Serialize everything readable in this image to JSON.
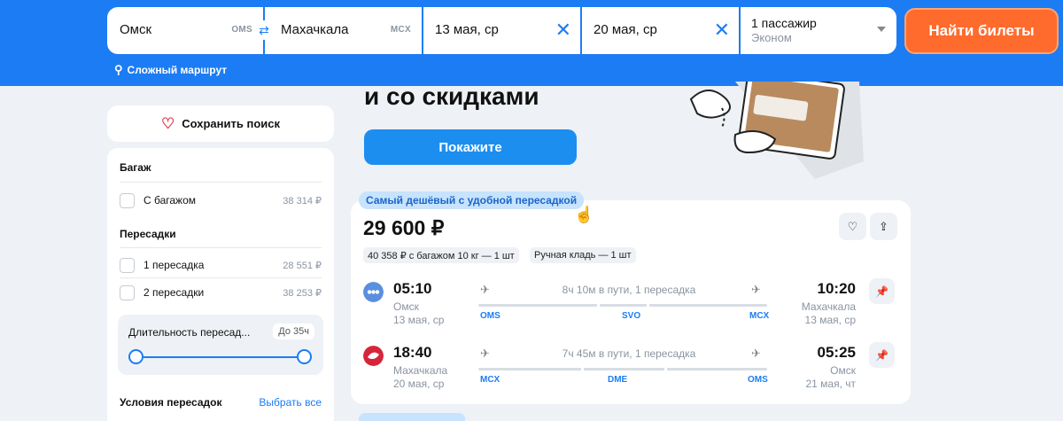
{
  "search": {
    "from_city": "Омск",
    "from_code": "OMS",
    "to_city": "Махачкала",
    "to_code": "MCX",
    "date_there": "13 мая, ср",
    "date_back": "20 мая, ср",
    "passengers": "1 пассажир",
    "cabin_class": "Эконом",
    "submit_label": "Найти билеты",
    "complex_route": "Сложный маршрут"
  },
  "promo": {
    "title": "и со скидками",
    "button": "Покажите"
  },
  "sidebar": {
    "save_search": "Сохранить поиск",
    "baggage_title": "Багаж",
    "baggage_option": "С багажом",
    "baggage_price": "38 314 ₽",
    "stops_title": "Пересадки",
    "stops": [
      {
        "label": "1 пересадка",
        "price": "28 551 ₽"
      },
      {
        "label": "2 пересадки",
        "price": "38 253 ₽"
      }
    ],
    "duration_label": "Длительность пересад...",
    "duration_value": "До 35ч",
    "conditions_title": "Условия пересадок",
    "select_all": "Выбрать все"
  },
  "ticket": {
    "badge": "Самый дешёвый с удобной пересадкой",
    "price": "29 600 ₽",
    "baggage_chip": "40 358 ₽ с багажом 10 кг — 1 шт",
    "hand_chip": "Ручная кладь — 1 шт",
    "segments": [
      {
        "dep_time": "05:10",
        "dep_city": "Омск",
        "dep_date": "13 мая, ср",
        "duration": "8ч 10м в пути, 1 пересадка",
        "from_code": "OMS",
        "via_code": "SVO",
        "to_code": "MCX",
        "arr_time": "10:20",
        "arr_city": "Махачкала",
        "arr_date": "13 мая, ср"
      },
      {
        "dep_time": "18:40",
        "dep_city": "Махачкала",
        "dep_date": "20 мая, ср",
        "duration": "7ч 45м в пути, 1 пересадка",
        "from_code": "MCX",
        "via_code": "DME",
        "to_code": "OMS",
        "arr_time": "05:25",
        "arr_city": "Омск",
        "arr_date": "21 мая, чт"
      }
    ]
  },
  "colors": {
    "brand_blue": "#1c7cf4",
    "cta_orange": "#ff6b2c",
    "airline1": "#5a8fe0",
    "airline2": "#d6253a"
  },
  "icons": [
    "swap-icon",
    "close-icon",
    "chevron-down-icon",
    "route-icon",
    "heart-icon",
    "share-icon",
    "pin-icon",
    "plane-takeoff-icon",
    "plane-landing-icon",
    "cursor-icon"
  ]
}
